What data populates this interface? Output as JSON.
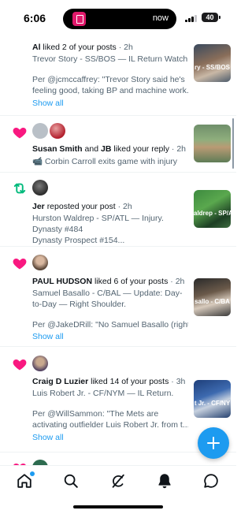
{
  "status_bar": {
    "time": "6:06",
    "live_activity": "now",
    "battery": "40"
  },
  "feed": [
    {
      "kind": "like",
      "actor": "Al",
      "action": "liked 2 of your posts",
      "time": "2h",
      "text": [
        "Trevor Story - SS/BOS — IL Return Watch."
      ],
      "quote": [
        "Per @jcmccaffrey: \"Trevor Story said he's",
        "feeling good, taking BP and machine work..."
      ],
      "show_all": "Show all",
      "thumb_caption": "ry - SS/BOS"
    },
    {
      "kind": "like",
      "actor": "Susan Smith",
      "connector": "and",
      "actor2": "JB",
      "action": "liked your reply",
      "time": "2h",
      "text": [
        "📹 Corbin Carroll exits game with injury"
      ],
      "thumb_caption": ""
    },
    {
      "kind": "repost",
      "actor": "Jer",
      "action": "reposted your post",
      "time": "2h",
      "text": [
        "Hurston Waldrep - SP/ATL — Injury.",
        "Dynasty #484",
        "Dynasty Prospect #154..."
      ],
      "thumb_caption": "aldrep - SP/A"
    },
    {
      "kind": "like",
      "actor": "PAUL HUDSON",
      "action": "liked 6 of your posts",
      "time": "2h",
      "text": [
        "Samuel Basallo - C/BAL — Update: Day-",
        "to-Day — Right Shoulder."
      ],
      "quote": [
        "Per @JakeDRill: \"No Samuel Basallo (right..."
      ],
      "show_all": "Show all",
      "thumb_caption": "sallo - C/BA"
    },
    {
      "kind": "like",
      "actor": "Craig D Luzier",
      "action": "liked 14 of your posts",
      "time": "3h",
      "text": [
        "Luis Robert Jr. - CF/NYM — IL Return."
      ],
      "quote": [
        "Per @WillSammon: \"The Mets are",
        "activating outfielder Luis Robert Jr. from t..."
      ],
      "show_all": "Show all",
      "thumb_caption": "t Jr. - CF/NY"
    }
  ],
  "colors": {
    "accent": "#1d9bf0",
    "like": "#f91880",
    "repost": "#00ba7c"
  },
  "nav": {
    "items": [
      "home-icon",
      "search-icon",
      "grok-icon",
      "notifications-icon",
      "messages-icon"
    ]
  }
}
